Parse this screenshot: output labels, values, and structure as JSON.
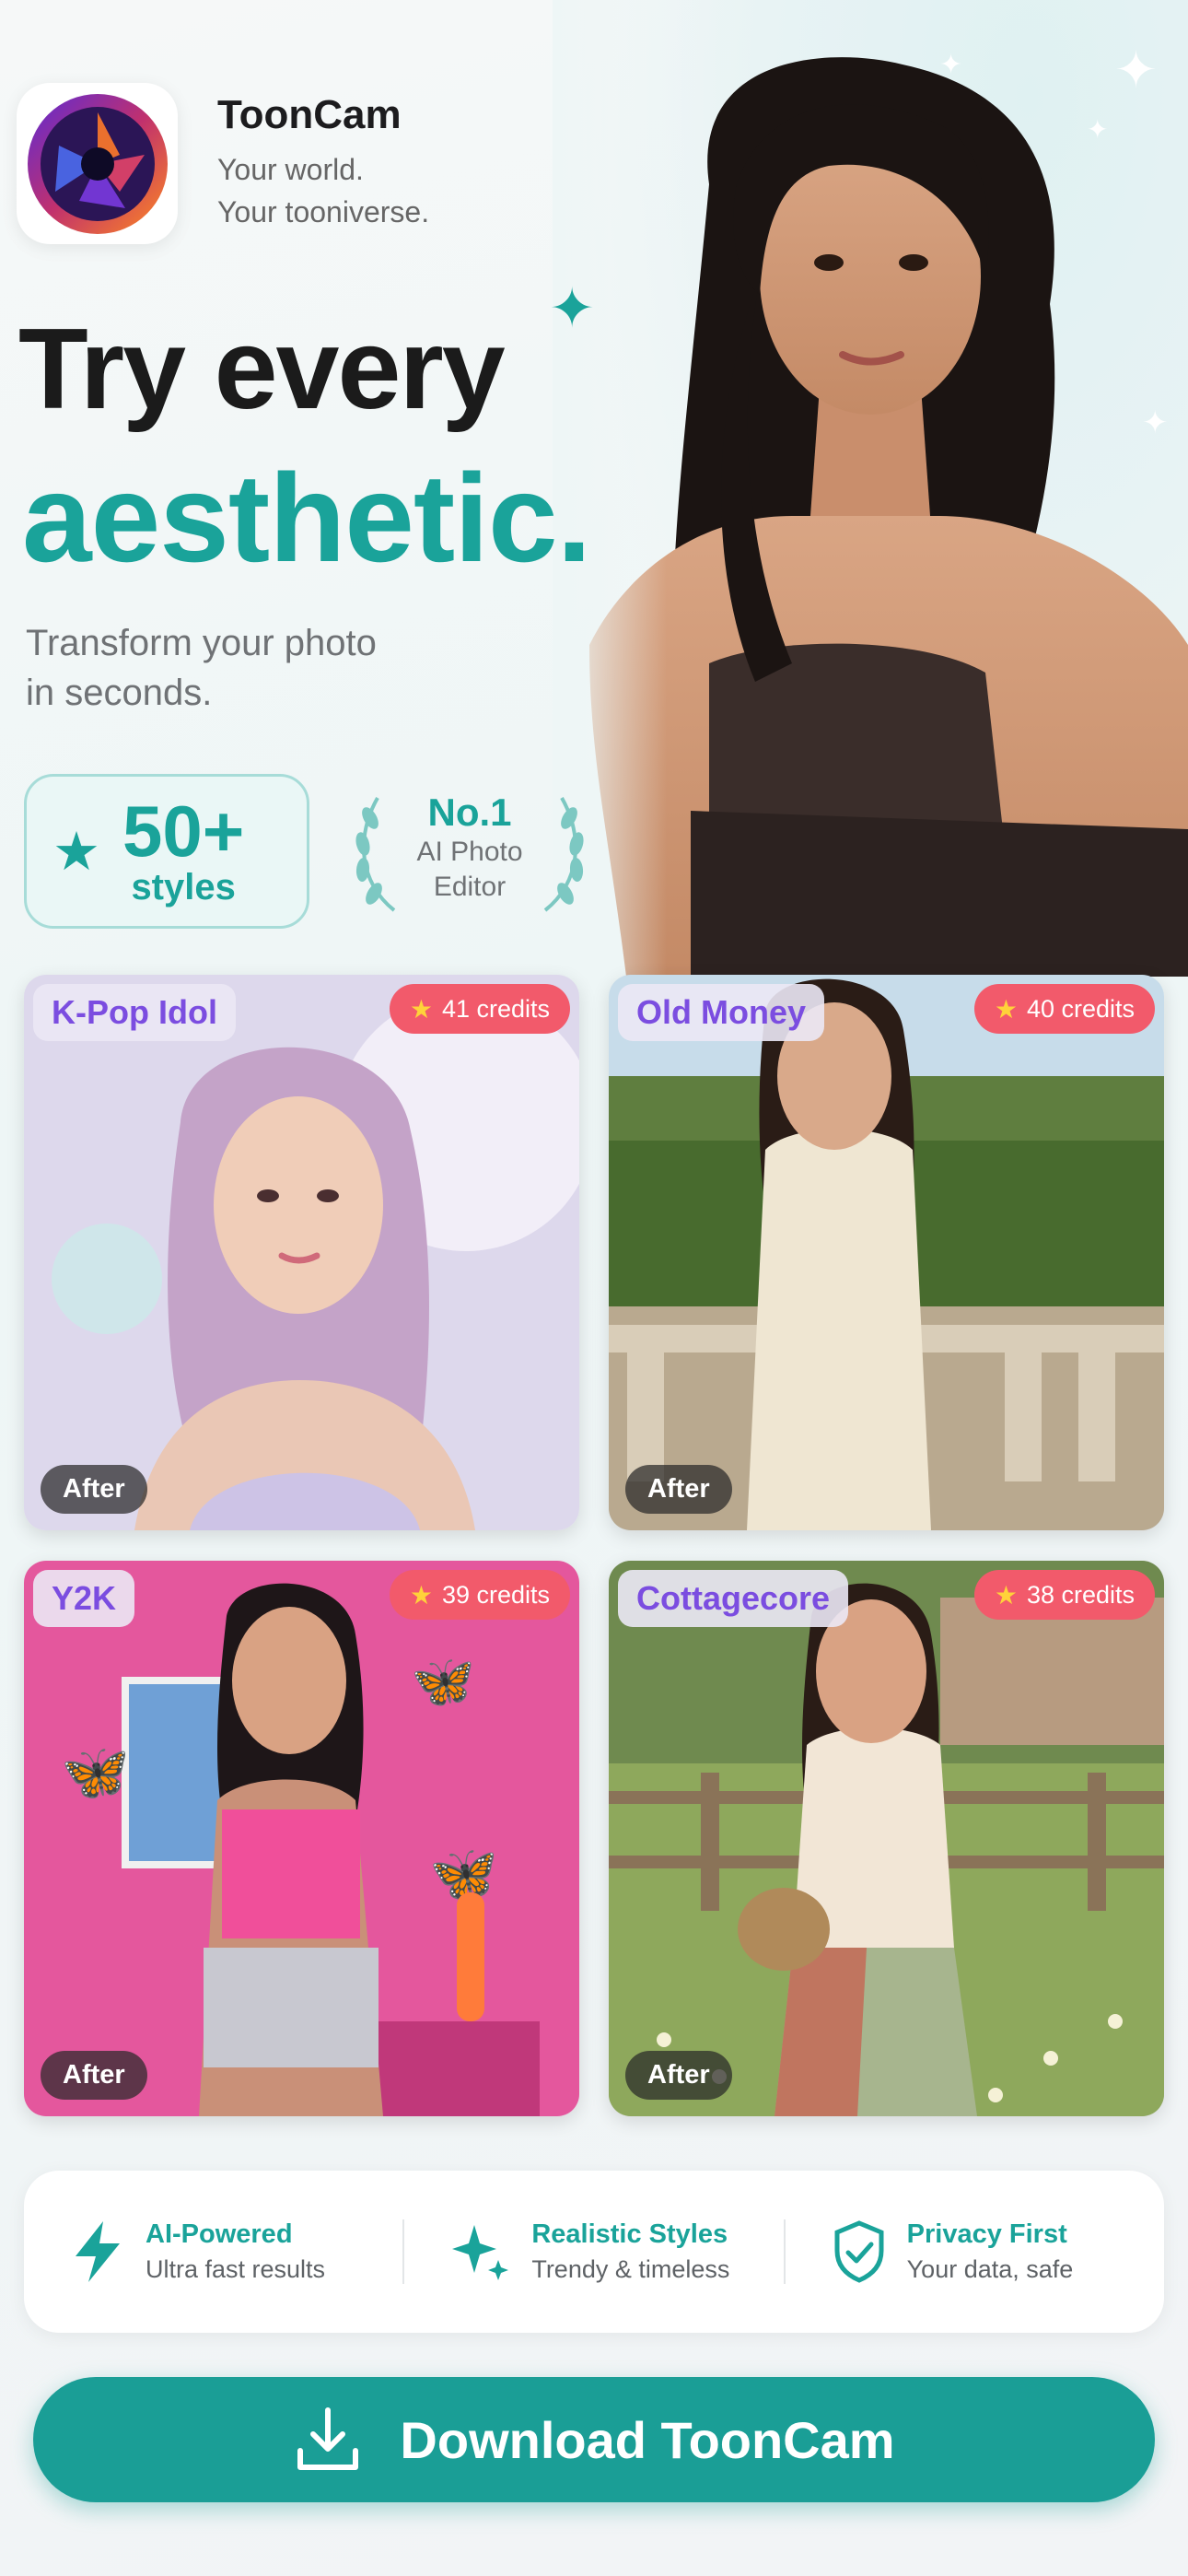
{
  "app": {
    "name": "ToonCam",
    "tagline_1": "Your world.",
    "tagline_2": "Your tooniverse."
  },
  "hero": {
    "headline_1": "Try every",
    "headline_2": "aesthetic",
    "subtitle_1": "Transform your photo",
    "subtitle_2": "in seconds."
  },
  "badges": {
    "styles_count": "50+",
    "styles_label": "styles",
    "rank": "No.1",
    "rank_line_1": "AI Photo",
    "rank_line_2": "Editor"
  },
  "cards": [
    {
      "label": "K-Pop Idol",
      "credits": "41 credits",
      "after": "After"
    },
    {
      "label": "Old Money",
      "credits": "40 credits",
      "after": "After"
    },
    {
      "label": "Y2K",
      "credits": "39 credits",
      "after": "After"
    },
    {
      "label": "Cottagecore",
      "credits": "38 credits",
      "after": "After"
    }
  ],
  "features": [
    {
      "title": "AI-Powered",
      "subtitle": "Ultra fast results",
      "icon": "lightning-icon"
    },
    {
      "title": "Realistic Styles",
      "subtitle": "Trendy & timeless",
      "icon": "sparkle-icon"
    },
    {
      "title": "Privacy First",
      "subtitle": "Your data, safe",
      "icon": "shield-check-icon"
    }
  ],
  "cta": {
    "label": "Download ToonCam",
    "icon": "download-icon"
  },
  "colors": {
    "accent": "#1aa39a",
    "label_purple": "#7b4de0",
    "credits_red": "#f25a6b"
  }
}
